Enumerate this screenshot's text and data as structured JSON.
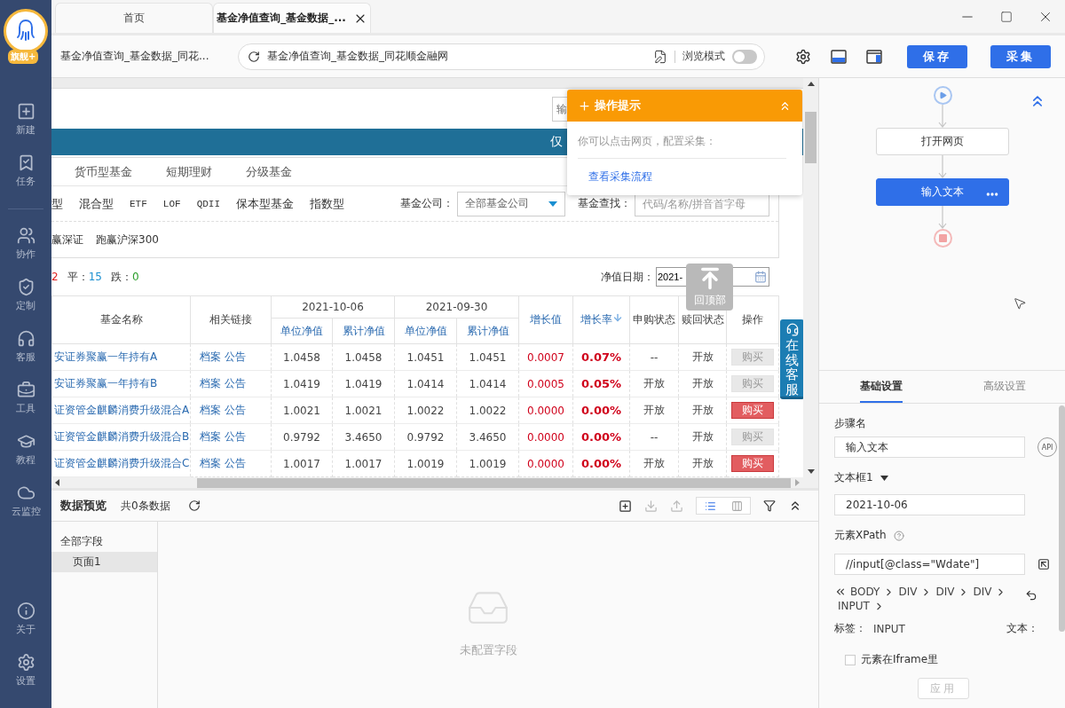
{
  "sidebar": {
    "badge": "旗舰+",
    "sections": [
      [
        {
          "label": "新建"
        },
        {
          "label": "任务"
        }
      ],
      [
        {
          "label": "协作"
        },
        {
          "label": "定制"
        },
        {
          "label": "客服"
        },
        {
          "label": "工具"
        },
        {
          "label": "教程"
        },
        {
          "label": "云监控"
        }
      ]
    ],
    "bottom": [
      {
        "label": "关于"
      },
      {
        "label": "设置"
      }
    ]
  },
  "tabs": [
    {
      "label": "首页",
      "selected": false
    },
    {
      "label": "基金净值查询_基金数据_...",
      "selected": true
    }
  ],
  "toolbar": {
    "page_title": "基金净值查询_基金数据_同花...",
    "url": "基金净值查询_基金数据_同花顺金融网",
    "browse_mode": {
      "label": "浏览模式",
      "on": false
    },
    "buttons": [
      "保存",
      "采集"
    ]
  },
  "webpage": {
    "search_placeholder_top": "输",
    "banner_text": "仅",
    "fund_tabs": [
      "货币型基金",
      "短期理财",
      "分级基金"
    ],
    "fund_types": [
      "型",
      "混合型",
      "ETF",
      "LOF",
      "QDII",
      "保本型基金",
      "指数型"
    ],
    "company_label": "基金公司：",
    "company_select": "全部基金公司",
    "search_label": "基金查找：",
    "search_placeholder": "代码/名称/拼音首字母",
    "quick_filters": [
      "赢深证",
      "跑赢沪深300"
    ],
    "stats": [
      {
        "kind": "up",
        "value": "2"
      },
      {
        "kind": "flat",
        "label": "平：",
        "value": "15"
      },
      {
        "kind": "down",
        "label": "跌：",
        "value": "0"
      }
    ],
    "date_label": "净值日期：",
    "date_value": "2021-",
    "table": {
      "columns": [
        {
          "label": "基金名称",
          "sortable": false,
          "sorted": false
        },
        {
          "label": "相关链接",
          "sortable": false,
          "sorted": false
        },
        {
          "group": "2021-10-06",
          "columns": [
            {
              "label": "单位净值",
              "sortable": true,
              "sorted": false
            },
            {
              "label": "累计净值",
              "sortable": true,
              "sorted": false
            }
          ]
        },
        {
          "group": "2021-09-30",
          "columns": [
            {
              "label": "单位净值",
              "sortable": true,
              "sorted": false
            },
            {
              "label": "累计净值",
              "sortable": true,
              "sorted": false
            }
          ]
        },
        {
          "label": "增长值",
          "sortable": true,
          "sorted": false
        },
        {
          "label": "增长率",
          "sortable": true,
          "sorted": true
        },
        {
          "label": "申购状态",
          "sortable": false,
          "sorted": false
        },
        {
          "label": "赎回状态",
          "sortable": false,
          "sorted": false
        },
        {
          "label": "操作",
          "sortable": false,
          "sorted": false
        }
      ],
      "rows": [
        {
          "name": "安证券聚赢一年持有A",
          "links": [
            "档案",
            "公告"
          ],
          "values": [
            "1.0458",
            "1.0458",
            "1.0451",
            "1.0451"
          ],
          "change": "0.0007",
          "rate": "0.07%",
          "subscribe": "--",
          "redeem": "开放",
          "action": {
            "label": "购买",
            "disabled": true
          }
        },
        {
          "name": "安证券聚赢一年持有B",
          "links": [
            "档案",
            "公告"
          ],
          "values": [
            "1.0419",
            "1.0419",
            "1.0414",
            "1.0414"
          ],
          "change": "0.0005",
          "rate": "0.05%",
          "subscribe": "开放",
          "redeem": "开放",
          "action": {
            "label": "购买",
            "disabled": true
          }
        },
        {
          "name": "证资管金麒麟消费升级混合A",
          "links": [
            "档案",
            "公告"
          ],
          "values": [
            "1.0021",
            "1.0021",
            "1.0022",
            "1.0022"
          ],
          "change": "0.0000",
          "rate": "0.00%",
          "subscribe": "开放",
          "redeem": "开放",
          "action": {
            "label": "购买",
            "disabled": false
          }
        },
        {
          "name": "证资管金麒麟消费升级混合B",
          "links": [
            "档案",
            "公告"
          ],
          "values": [
            "0.9792",
            "3.4650",
            "0.9792",
            "3.4650"
          ],
          "change": "0.0000",
          "rate": "0.00%",
          "subscribe": "--",
          "redeem": "开放",
          "action": {
            "label": "购买",
            "disabled": true
          }
        },
        {
          "name": "证资管金麒麟消费升级混合C",
          "links": [
            "档案",
            "公告"
          ],
          "values": [
            "1.0017",
            "1.0017",
            "1.0019",
            "1.0019"
          ],
          "change": "0.0000",
          "rate": "0.00%",
          "subscribe": "开放",
          "redeem": "开放",
          "action": {
            "label": "购买",
            "disabled": false
          }
        }
      ]
    },
    "back_to_top": "回顶部",
    "online_service": "在线客服"
  },
  "tip_popup": {
    "title": "操作提示",
    "body": "你可以点击网页，配置采集：",
    "link": "查看采集流程"
  },
  "data_preview": {
    "title": "数据预览",
    "count": "共0条数据",
    "views": [
      {
        "kind": "list",
        "selected": true
      },
      {
        "kind": "grid",
        "selected": false
      }
    ],
    "fields": {
      "label": "全部字段",
      "children": [
        {
          "label": "页面1",
          "selected": true
        }
      ]
    },
    "empty_text": "未配置字段"
  },
  "flow": [
    {
      "kind": "start"
    },
    {
      "kind": "step",
      "label": "打开网页",
      "selected": false
    },
    {
      "kind": "step",
      "label": "输入文本",
      "selected": true
    },
    {
      "kind": "end"
    }
  ],
  "settings": {
    "tabs": [
      {
        "label": "基础设置",
        "selected": true
      },
      {
        "label": "高级设置",
        "selected": false
      }
    ],
    "step_name_label": "步骤名",
    "step_name_value": "输入文本",
    "api_badge": "API",
    "textbox_label": "文本框1",
    "textbox_value": "2021-10-06",
    "xpath_label": "元素XPath",
    "xpath_value": "//input[@class=\"Wdate\"]",
    "breadcrumb": [
      "BODY",
      "DIV",
      "DIV",
      "DIV",
      "INPUT"
    ],
    "tag_label": "标签：",
    "tag_value": "INPUT",
    "text_label": "文本：",
    "iframe_checkbox": {
      "label": "元素在Iframe里",
      "checked": false
    },
    "apply_button": {
      "label": "应用",
      "disabled": true
    }
  }
}
